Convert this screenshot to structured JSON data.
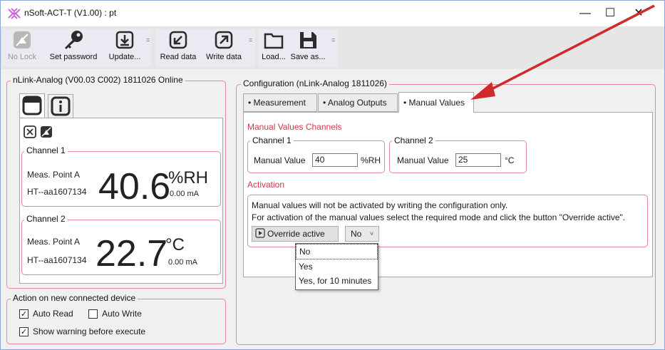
{
  "window": {
    "title": "nSoft-ACT-T (V1.00) : pt",
    "minimize": "—",
    "maximize": "☐",
    "close": "✕"
  },
  "toolbar": {
    "no_lock": "No Lock",
    "set_password": "Set password",
    "update": "Update...",
    "read_data": "Read data",
    "write_data": "Write data",
    "load": "Load...",
    "save_as": "Save as...",
    "overflow": "="
  },
  "device_panel": {
    "legend": "nLink-Analog (V00.03 C002) 1811026 Online",
    "channel1": {
      "legend": "Channel 1",
      "point": "Meas. Point A",
      "sensor": "HT--aa1607134",
      "value": "40.6",
      "unit": "%RH",
      "current": "0.00 mA"
    },
    "channel2": {
      "legend": "Channel 2",
      "point": "Meas. Point A",
      "sensor": "HT--aa1607134",
      "value": "22.7",
      "unit": "°C",
      "current": "0.00 mA"
    }
  },
  "action_panel": {
    "legend": "Action on new connected device",
    "auto_read": "Auto Read",
    "auto_read_checked": true,
    "auto_write": "Auto Write",
    "auto_write_checked": false,
    "show_warning": "Show warning before execute",
    "show_warning_checked": true
  },
  "config_panel": {
    "legend": "Configuration (nLink-Analog 1811026)",
    "tabs": [
      "• Measurement",
      "• Analog Outputs",
      "• Manual Values"
    ],
    "active_tab": "• Manual Values",
    "manual_values_heading": "Manual Values Channels",
    "channel1": {
      "legend": "Channel 1",
      "label": "Manual Value",
      "value": "40",
      "unit": "%RH"
    },
    "channel2": {
      "legend": "Channel 2",
      "label": "Manual Value",
      "value": "25",
      "unit": "°C"
    },
    "activation_heading": "Activation",
    "activation_line1": "Manual values will not be activated by writing the configuration only.",
    "activation_line2": "For activation of the manual values select the required mode and click the button \"Override active\".",
    "override_button": "Override active",
    "mode_selected": "No",
    "mode_options": [
      "No",
      "Yes",
      "Yes, for 10 minutes"
    ]
  },
  "colors": {
    "accent_pink": "#e4889e",
    "heading_red": "#d0374f",
    "annotation_arrow": "#d02a2a"
  }
}
